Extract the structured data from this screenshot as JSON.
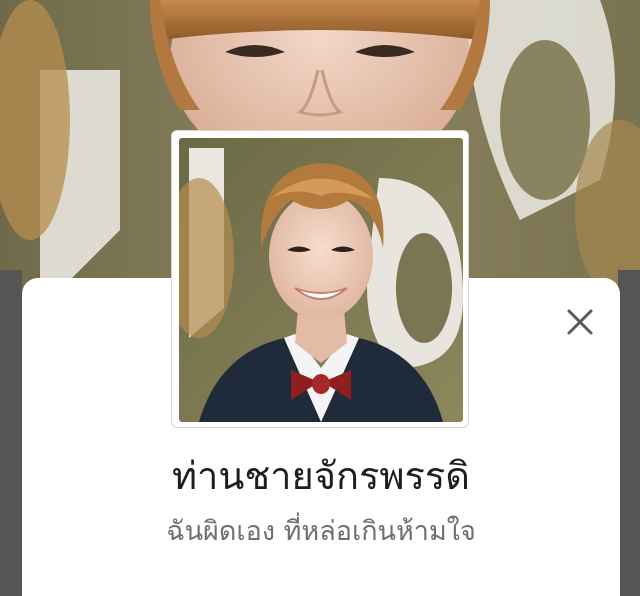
{
  "profile": {
    "display_name": "ท่านชายจักรพรรดิ",
    "status_message": "ฉันผิดเอง ที่หล่อเกินห้ามใจ"
  },
  "icons": {
    "close": "close-icon"
  },
  "colors": {
    "sheet_background": "#ffffff",
    "name_text": "#1e1e1e",
    "status_text": "#6f6f6f",
    "close_icon": "#5a5a5a"
  }
}
